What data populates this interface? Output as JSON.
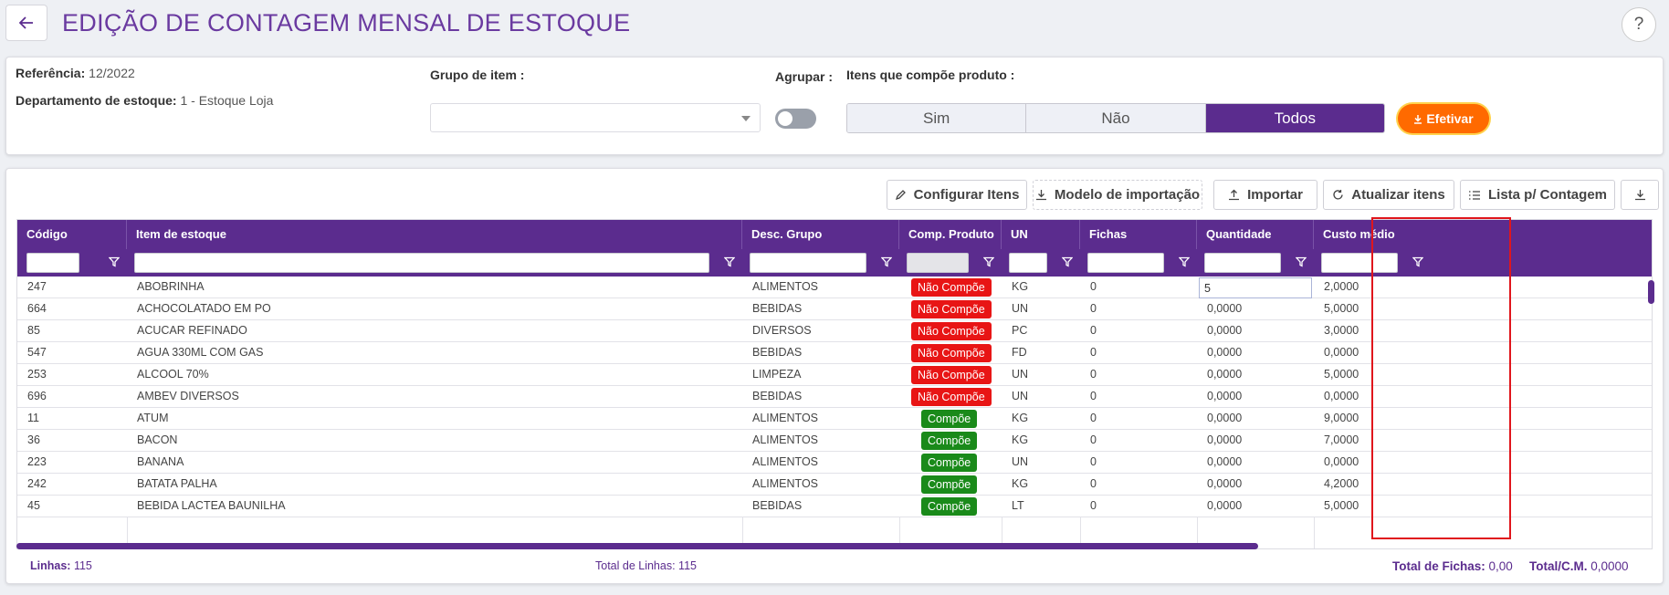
{
  "header": {
    "title": "EDIÇÃO DE CONTAGEM MENSAL DE ESTOQUE",
    "help": "?"
  },
  "filters": {
    "referencia_label": "Referência:",
    "referencia_value": "12/2022",
    "departamento_label": "Departamento de estoque:",
    "departamento_value": "1 - Estoque Loja",
    "grupo_label": "Grupo de item :",
    "grupo_value": "",
    "agrupar_label": "Agrupar :",
    "itens_label": "Itens que compõe produto :",
    "segments": [
      "Sim",
      "Não",
      "Todos"
    ],
    "active_segment": "Todos",
    "efetivar_label": "Efetivar",
    "accent": "#5b2c8e",
    "efetivar_color": "#ff6a00"
  },
  "toolbar": {
    "configurar": "Configurar Itens",
    "modelo": "Modelo de importação",
    "importar": "Importar",
    "atualizar": "Atualizar itens",
    "lista": "Lista p/ Contagem"
  },
  "grid": {
    "columns": [
      "Código",
      "Item de estoque",
      "Desc. Grupo",
      "Comp. Produto",
      "UN",
      "Fichas",
      "Quantidade",
      "Custo médio"
    ],
    "rows": [
      {
        "codigo": "247",
        "item": "ABOBRINHA",
        "grupo": "ALIMENTOS",
        "comp": "Não Compõe",
        "un": "KG",
        "fichas": "0",
        "quantidade": "5",
        "custo": "2,0000"
      },
      {
        "codigo": "664",
        "item": "ACHOCOLATADO EM PO",
        "grupo": "BEBIDAS",
        "comp": "Não Compõe",
        "un": "UN",
        "fichas": "0",
        "quantidade": "0,0000",
        "custo": "5,0000"
      },
      {
        "codigo": "85",
        "item": "ACUCAR REFINADO",
        "grupo": "DIVERSOS",
        "comp": "Não Compõe",
        "un": "PC",
        "fichas": "0",
        "quantidade": "0,0000",
        "custo": "3,0000"
      },
      {
        "codigo": "547",
        "item": "AGUA 330ML COM GAS",
        "grupo": "BEBIDAS",
        "comp": "Não Compõe",
        "un": "FD",
        "fichas": "0",
        "quantidade": "0,0000",
        "custo": "0,0000"
      },
      {
        "codigo": "253",
        "item": "ALCOOL 70%",
        "grupo": "LIMPEZA",
        "comp": "Não Compõe",
        "un": "UN",
        "fichas": "0",
        "quantidade": "0,0000",
        "custo": "5,0000"
      },
      {
        "codigo": "696",
        "item": "AMBEV DIVERSOS",
        "grupo": "BEBIDAS",
        "comp": "Não Compõe",
        "un": "UN",
        "fichas": "0",
        "quantidade": "0,0000",
        "custo": "0,0000"
      },
      {
        "codigo": "11",
        "item": "ATUM",
        "grupo": "ALIMENTOS",
        "comp": "Compõe",
        "un": "KG",
        "fichas": "0",
        "quantidade": "0,0000",
        "custo": "9,0000"
      },
      {
        "codigo": "36",
        "item": "BACON",
        "grupo": "ALIMENTOS",
        "comp": "Compõe",
        "un": "KG",
        "fichas": "0",
        "quantidade": "0,0000",
        "custo": "7,0000"
      },
      {
        "codigo": "223",
        "item": "BANANA",
        "grupo": "ALIMENTOS",
        "comp": "Compõe",
        "un": "UN",
        "fichas": "0",
        "quantidade": "0,0000",
        "custo": "0,0000"
      },
      {
        "codigo": "242",
        "item": "BATATA PALHA",
        "grupo": "ALIMENTOS",
        "comp": "Compõe",
        "un": "KG",
        "fichas": "0",
        "quantidade": "0,0000",
        "custo": "4,2000"
      },
      {
        "codigo": "45",
        "item": "BEBIDA LACTEA BAUNILHA",
        "grupo": "BEBIDAS",
        "comp": "Compõe",
        "un": "LT",
        "fichas": "0",
        "quantidade": "0,0000",
        "custo": "5,0000"
      }
    ],
    "comp_colors": {
      "Não Compõe": "#e81515",
      "Compõe": "#1a8a1a"
    }
  },
  "footer": {
    "linhas_label": "Linhas:",
    "linhas_value": "115",
    "total_linhas_label": "Total de Linhas:",
    "total_linhas_value": "115",
    "total_fichas_label": "Total de Fichas:",
    "total_fichas_value": "0,00",
    "total_cm_label": "Total/C.M.",
    "total_cm_value": "0,0000"
  }
}
